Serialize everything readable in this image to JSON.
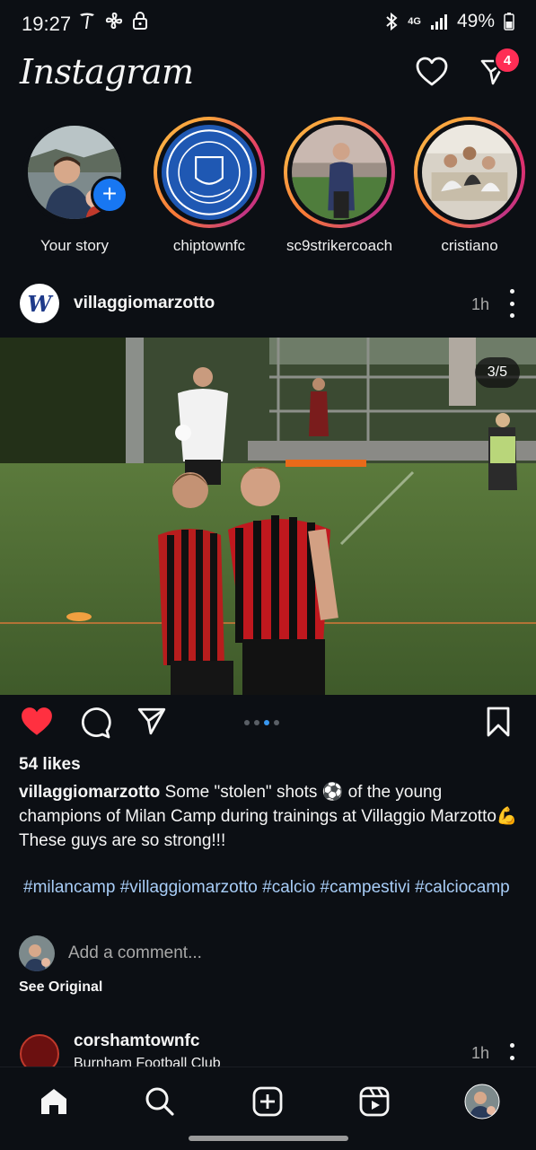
{
  "status_bar": {
    "time": "19:27",
    "network": "4G",
    "battery": "49%",
    "left_icons": [
      "tesla-icon",
      "fan-icon",
      "lock-icon"
    ],
    "right_icons": [
      "bluetooth-icon",
      "signal-icon",
      "battery-icon"
    ]
  },
  "header": {
    "logo": "Instagram",
    "notification_badge": "4"
  },
  "stories": [
    {
      "label": "Your story",
      "own": true
    },
    {
      "label": "chiptownfc",
      "own": false
    },
    {
      "label": "sc9strikercoach",
      "own": false
    },
    {
      "label": "cristiano",
      "own": false
    }
  ],
  "post": {
    "username": "villaggiomarzotto",
    "time": "1h",
    "counter": "3/5",
    "carousel_total": 5,
    "carousel_active": 3,
    "likes": "54 likes",
    "caption_user": "villaggiomarzotto",
    "caption_text": " Some \"stolen\" shots ⚽ of the young champions of Milan Camp during trainings at Villaggio Marzotto💪 These guys are so strong!!!",
    "hashtags": "#milancamp #villaggiomarzotto #calcio #campestivi #calciocamp",
    "comment_placeholder": "Add a comment...",
    "see_original": "See Original",
    "liked": true
  },
  "next_post": {
    "username": "corshamtownfc",
    "subtitle": "Burnham Football Club",
    "time": "1h"
  },
  "colors": {
    "background": "#0c0f14",
    "like_red": "#ff3040",
    "hashtag_blue": "#a8cdf7",
    "badge": "#ff2d55",
    "add_story_blue": "#1877f2"
  },
  "nav": [
    "home-icon",
    "search-icon",
    "create-icon",
    "reels-icon",
    "profile-avatar"
  ]
}
